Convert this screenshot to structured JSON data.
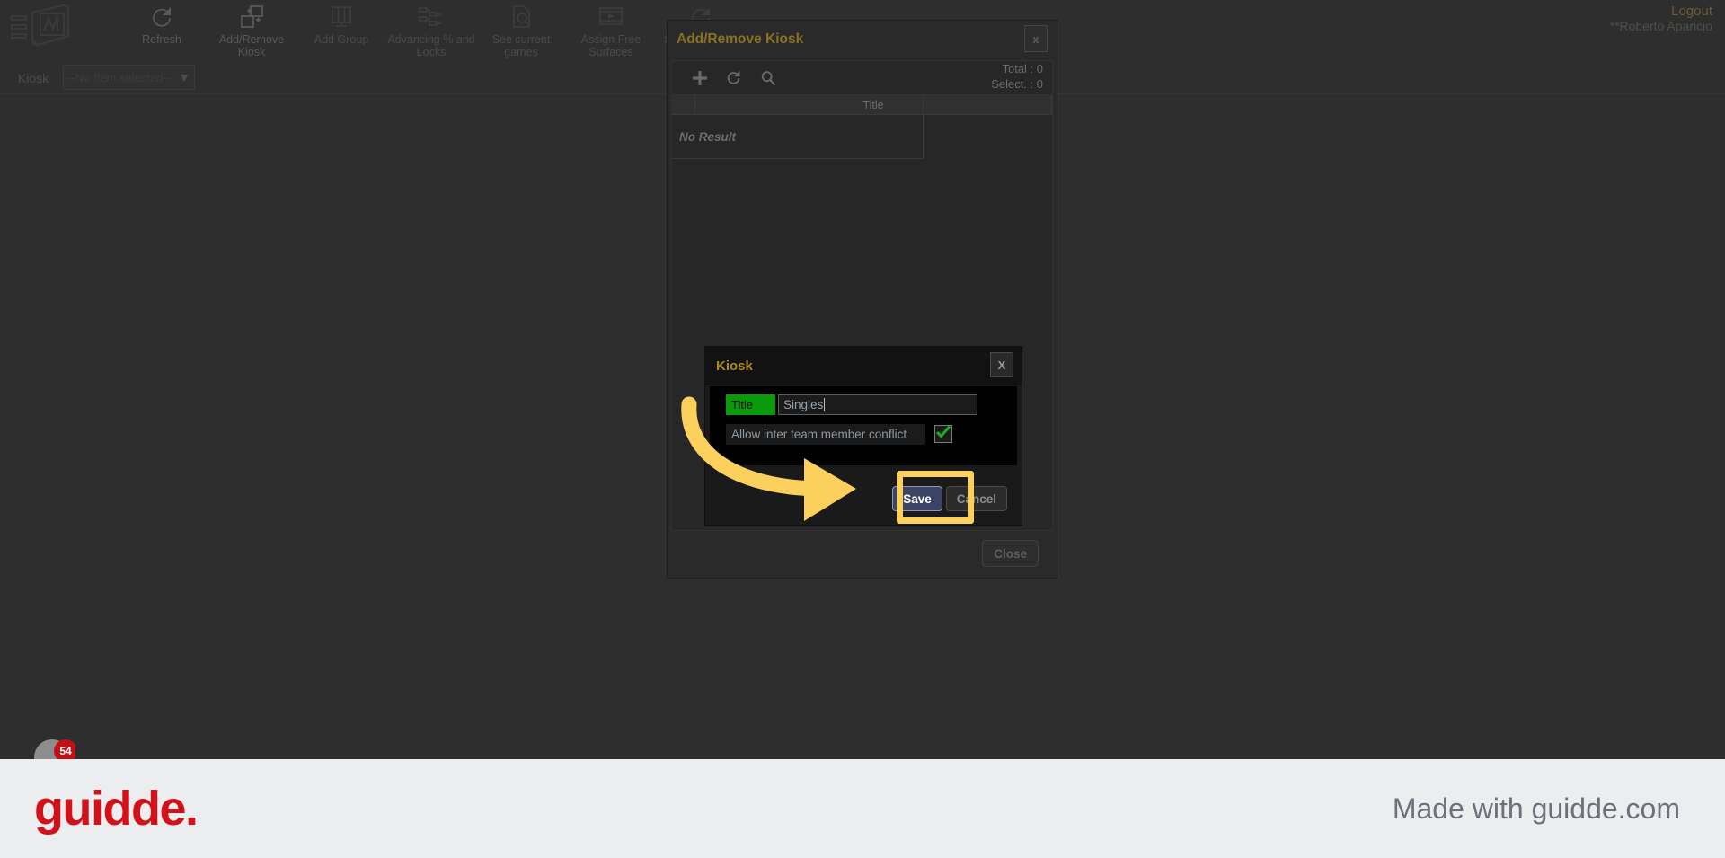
{
  "app": {
    "logo_icon": "book-chart-logo-icon"
  },
  "toolbar": {
    "items": [
      {
        "label": "Refresh",
        "icon": "refresh-icon"
      },
      {
        "label": "Add/Remove Kiosk",
        "icon": "add-remove-kiosk-icon"
      },
      {
        "label": "Add Group",
        "icon": "add-group-icon"
      },
      {
        "label": "Advancing % and Locks",
        "icon": "advancing-locks-icon"
      },
      {
        "label": "See current games",
        "icon": "see-current-games-icon"
      },
      {
        "label": "Assign Free Surfaces",
        "icon": "assign-free-surfaces-icon"
      },
      {
        "label": "Show reassign",
        "icon": "show-reassign-icon"
      }
    ]
  },
  "account": {
    "logout_label": "Logout",
    "user_name": "**Roberto Aparicio"
  },
  "selector": {
    "label": "Kiosk",
    "value": "--No Item selected--",
    "chevron_icon": "chevron-down-icon"
  },
  "modal": {
    "title": "Add/Remove Kiosk",
    "close_x": "x",
    "tools": [
      {
        "name": "add-icon"
      },
      {
        "name": "refresh-icon"
      },
      {
        "name": "search-icon"
      }
    ],
    "counts": {
      "total": "Total : 0",
      "selected": "Select. : 0"
    },
    "grid": {
      "columns": [
        "",
        "Title"
      ],
      "empty_text": "No Result",
      "rows": []
    },
    "close_button": "Close"
  },
  "dialog": {
    "title": "Kiosk",
    "close_x": "X",
    "fields": {
      "title_label": "Title",
      "title_value": "Singles",
      "title_placeholder": "",
      "conflict_label": "Allow inter team member conflict",
      "conflict_checked": true,
      "check_icon": "checkmark-icon"
    },
    "save_button": "Save",
    "cancel_button": "Cancel"
  },
  "annotation": {
    "arrow_icon": "curved-arrow-icon",
    "highlight_color": "#fbd05c",
    "target": "save-button"
  },
  "footer": {
    "logo_text": "guidde.",
    "made_with": "Made with guidde.com",
    "badge_count": "54"
  },
  "colors": {
    "accent_gold": "#b08a18",
    "modal_gold": "#8a7023",
    "green_label": "#0b9a0b",
    "save_blue": "#3b4465",
    "brand_red": "#d1121a",
    "highlight_yellow": "#fbd05c"
  }
}
